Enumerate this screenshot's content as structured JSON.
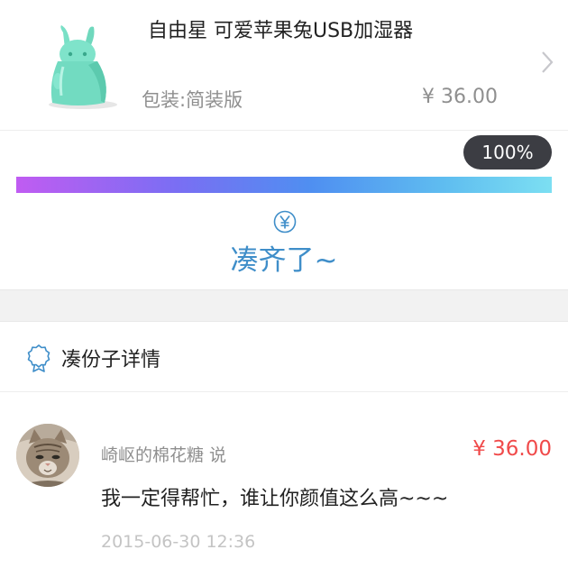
{
  "product": {
    "title": "自由星 可爱苹果兔USB加湿器",
    "spec": "包装:简装版",
    "price": "¥ 36.00",
    "icon": "chevron-right-icon",
    "accent": "#6fdcc0"
  },
  "progress": {
    "percent_label": "100%",
    "fraction": 1.0,
    "status": "凑齐了~",
    "icon": "yen-icon",
    "accent": "#3f8ec9"
  },
  "details": {
    "title": "凑份子详情",
    "icon": "ribbon-icon"
  },
  "contributions": [
    {
      "name": "崎岖的棉花糖 说",
      "amount": "¥ 36.00",
      "message": "我一定得帮忙，谁让你颜值这么高~~~",
      "time": "2015-06-30 12:36",
      "amount_color": "#f04a4a"
    }
  ]
}
